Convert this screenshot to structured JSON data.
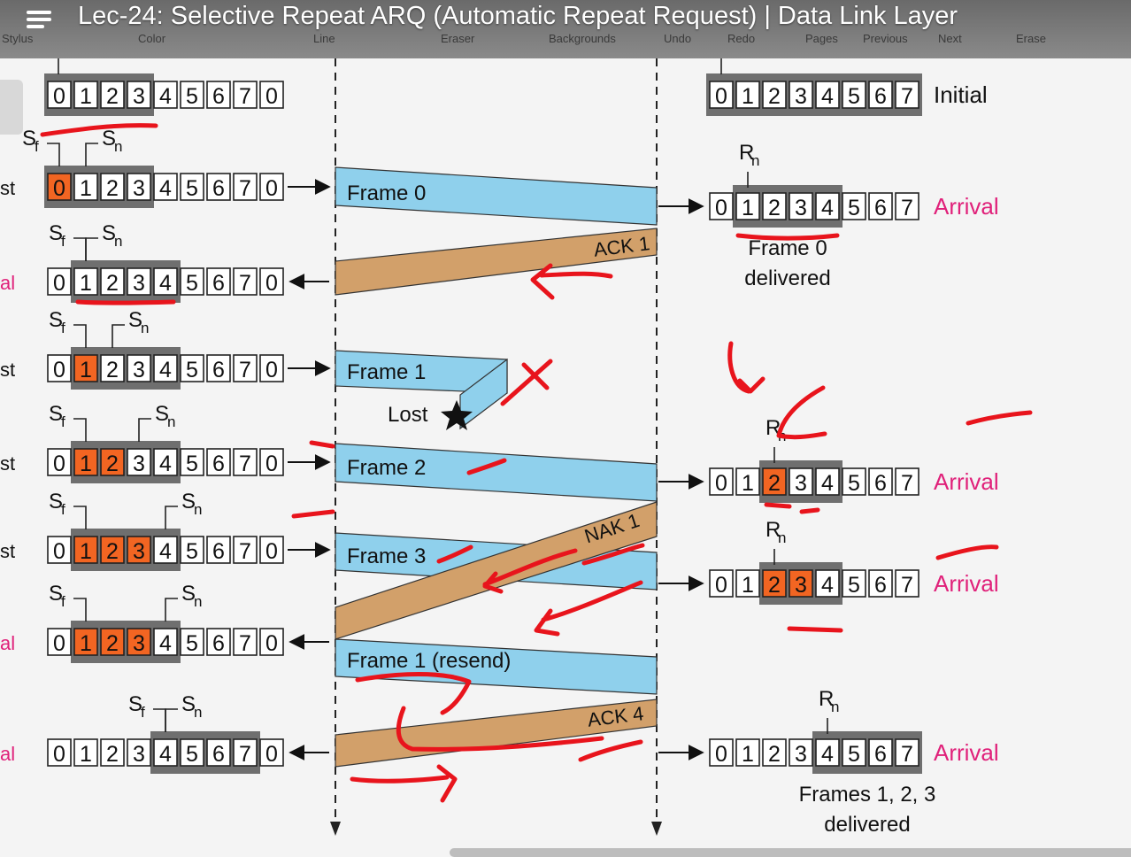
{
  "video": {
    "title": "Lec-24: Selective Repeat ARQ (Automatic Repeat Request) | Data Link Layer",
    "toolbar": [
      "Stylus",
      "Color",
      "Line",
      "Eraser",
      "Backgrounds",
      "Undo",
      "Redo",
      "Pages",
      "Previous",
      "Next",
      "Erase"
    ]
  },
  "colors": {
    "sent": "#f26522",
    "frame": "#8fd0ec",
    "ack": "#d2a06a",
    "receiver_label": "#e0217a",
    "annotation": "#e8141c"
  },
  "sender_rows": [
    {
      "side": "",
      "cells": [
        "0",
        "1",
        "2",
        "3",
        "4",
        "5",
        "6",
        "7",
        "0"
      ],
      "sent": []
    },
    {
      "side": "st",
      "cells": [
        "0",
        "1",
        "2",
        "3",
        "4",
        "5",
        "6",
        "7",
        "0"
      ],
      "sent": [
        0
      ]
    },
    {
      "side": "al",
      "cells": [
        "0",
        "1",
        "2",
        "3",
        "4",
        "5",
        "6",
        "7",
        "0"
      ],
      "sent": []
    },
    {
      "side": "st",
      "cells": [
        "0",
        "1",
        "2",
        "3",
        "4",
        "5",
        "6",
        "7",
        "0"
      ],
      "sent": [
        1
      ]
    },
    {
      "side": "st",
      "cells": [
        "0",
        "1",
        "2",
        "3",
        "4",
        "5",
        "6",
        "7",
        "0"
      ],
      "sent": [
        1,
        2
      ]
    },
    {
      "side": "st",
      "cells": [
        "0",
        "1",
        "2",
        "3",
        "4",
        "5",
        "6",
        "7",
        "0"
      ],
      "sent": [
        1,
        2,
        3
      ]
    },
    {
      "side": "al",
      "cells": [
        "0",
        "1",
        "2",
        "3",
        "4",
        "5",
        "6",
        "7",
        "0"
      ],
      "sent": [
        1,
        2,
        3
      ]
    },
    {
      "side": "al",
      "cells": [
        "0",
        "1",
        "2",
        "3",
        "4",
        "5",
        "6",
        "7",
        "0"
      ],
      "sent": []
    }
  ],
  "pointers": {
    "sf": "S",
    "sf_sub": "f",
    "sn": "S",
    "sn_sub": "n",
    "rn": "R",
    "rn_sub": "n"
  },
  "receiver_rows": [
    {
      "cells": [
        "0",
        "1",
        "2",
        "3",
        "4",
        "5",
        "6",
        "7"
      ],
      "received": [],
      "label": "Initial",
      "label_kind": "initial"
    },
    {
      "cells": [
        "0",
        "1",
        "2",
        "3",
        "4",
        "5",
        "6",
        "7"
      ],
      "received": [],
      "label": "Arrival",
      "label_kind": "arrival",
      "note": [
        "Frame 0",
        "delivered"
      ]
    },
    {
      "cells": [
        "0",
        "1",
        "2",
        "3",
        "4",
        "5",
        "6",
        "7"
      ],
      "received": [
        2
      ],
      "label": "Arrival",
      "label_kind": "arrival"
    },
    {
      "cells": [
        "0",
        "1",
        "2",
        "3",
        "4",
        "5",
        "6",
        "7"
      ],
      "received": [
        2,
        3
      ],
      "label": "Arrival",
      "label_kind": "arrival"
    },
    {
      "cells": [
        "0",
        "1",
        "2",
        "3",
        "4",
        "5",
        "6",
        "7"
      ],
      "received": [],
      "label": "Arrival",
      "label_kind": "arrival",
      "note": [
        "Frames 1, 2, 3",
        "delivered"
      ]
    }
  ],
  "messages": [
    {
      "id": "frame0",
      "kind": "frame",
      "label": "Frame 0"
    },
    {
      "id": "ack1",
      "kind": "ack",
      "label": "ACK 1"
    },
    {
      "id": "frame1",
      "kind": "frame",
      "label": "Frame 1",
      "lost_label": "Lost"
    },
    {
      "id": "frame2",
      "kind": "frame",
      "label": "Frame 2"
    },
    {
      "id": "frame3",
      "kind": "frame",
      "label": "Frame 3"
    },
    {
      "id": "nak1",
      "kind": "ack",
      "label": "NAK 1"
    },
    {
      "id": "frame1resend",
      "kind": "frame",
      "label": "Frame 1 (resend)"
    },
    {
      "id": "ack4",
      "kind": "ack",
      "label": "ACK 4"
    }
  ]
}
